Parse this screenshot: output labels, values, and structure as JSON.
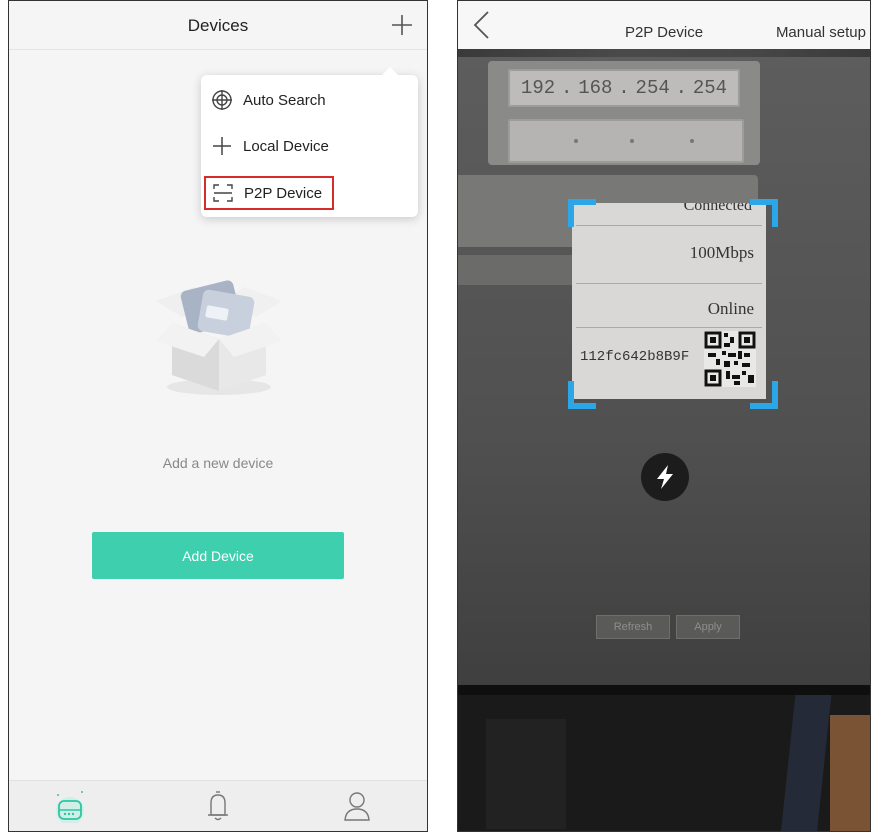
{
  "left": {
    "header": {
      "title": "Devices"
    },
    "menu": {
      "items": [
        {
          "label": "Auto Search",
          "icon": "auto-search-icon"
        },
        {
          "label": "Local Device",
          "icon": "plus-icon"
        },
        {
          "label": "P2P Device",
          "icon": "scan-icon"
        }
      ]
    },
    "empty_state": {
      "text": "Add a new device"
    },
    "add_button": {
      "label": "Add Device"
    },
    "tabbar": {
      "tabs": [
        {
          "name": "devices",
          "icon": "device-box-icon"
        },
        {
          "name": "alarms",
          "icon": "bell-icon"
        },
        {
          "name": "profile",
          "icon": "user-icon"
        }
      ],
      "accent": "#3ecfae"
    }
  },
  "right": {
    "header": {
      "title": "P2P Device",
      "manual_label": "Manual setup"
    },
    "camera": {
      "ip_parts": [
        "192",
        ".",
        "168",
        ".",
        "254",
        ".",
        "254"
      ],
      "status_connected": "Connected",
      "speed": "100Mbps",
      "online": "Online",
      "device_id": "112fc642b8B9F",
      "refresh_label": "Refresh",
      "apply_label": "Apply",
      "scan_frame_color": "#2ba7e8"
    }
  }
}
